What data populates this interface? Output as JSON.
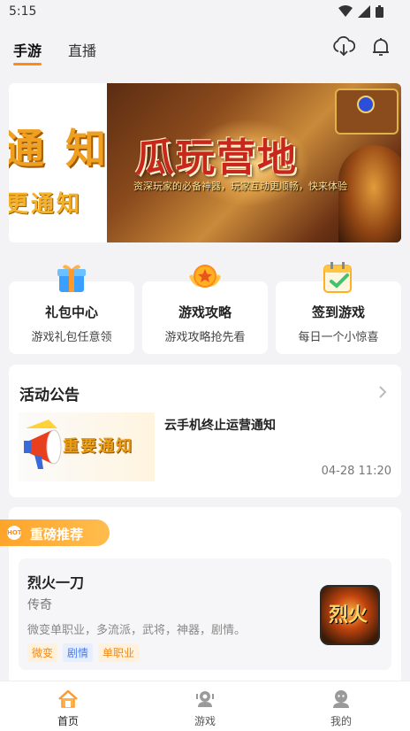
{
  "status": {
    "time": "5:15"
  },
  "topnav": {
    "tabs": [
      {
        "label": "手游",
        "active": true
      },
      {
        "label": "直播",
        "active": false
      }
    ],
    "icons": [
      "download-icon",
      "bell-icon"
    ]
  },
  "banner": {
    "left_big": "通 知",
    "left_small": "更通知",
    "title": "瓜玩营地",
    "subtitle": "资深玩家的必备神器，玩家互动更顺畅，快来体验"
  },
  "cards": [
    {
      "title": "礼包中心",
      "subtitle": "游戏礼包任意领",
      "icon": "gift-icon"
    },
    {
      "title": "游戏攻略",
      "subtitle": "游戏攻略抢先看",
      "icon": "medal-icon"
    },
    {
      "title": "签到游戏",
      "subtitle": "每日一个小惊喜",
      "icon": "calendar-check-icon"
    }
  ],
  "activity": {
    "title": "活动公告",
    "thumb_text": "重要通知",
    "notice_title": "云手机终止运营通知",
    "notice_time": "04-28 11:20"
  },
  "recommend": {
    "label": "重磅推荐",
    "hot_badge": "HOT",
    "game": {
      "name": "烈火一刀",
      "category": "传奇",
      "description": "微变单职业，多流派，武将，神器，剧情。",
      "tags": [
        "微变",
        "剧情",
        "单职业"
      ],
      "icon_text": "烈火"
    }
  },
  "bottom_nav": [
    {
      "label": "首页",
      "active": true,
      "icon": "home-icon"
    },
    {
      "label": "游戏",
      "active": false,
      "icon": "game-controller-icon"
    },
    {
      "label": "我的",
      "active": false,
      "icon": "profile-icon"
    }
  ],
  "colors": {
    "accent": "#ff8a1a",
    "background": "#f3f3f5"
  }
}
